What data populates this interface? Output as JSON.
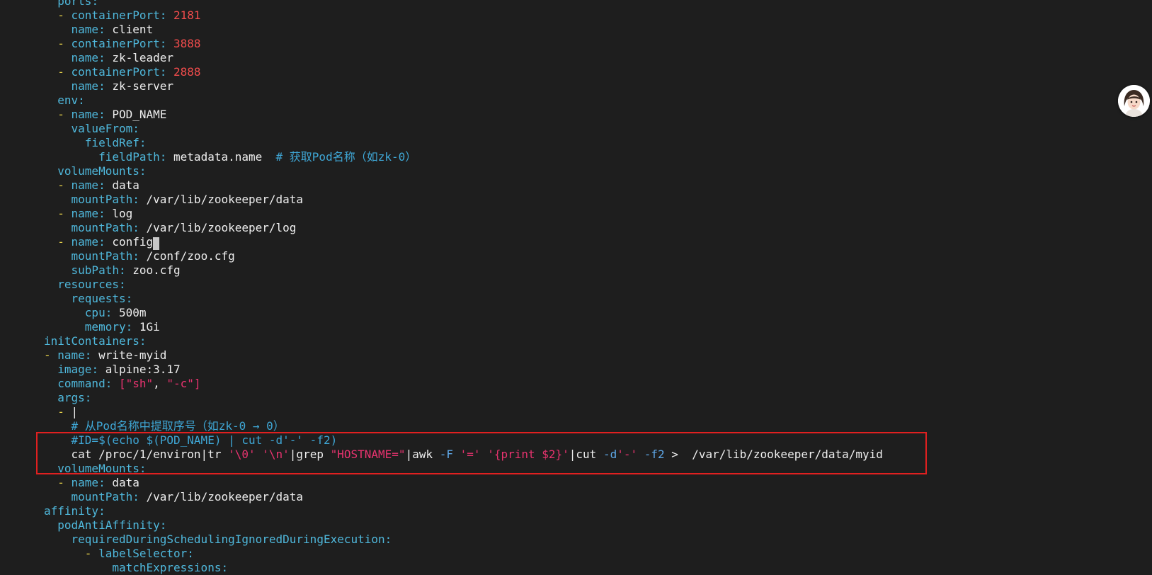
{
  "editor": {
    "lines": [
      [
        [
          "  ",
          "ws"
        ],
        [
          "ports",
          "key"
        ],
        [
          ":",
          "key"
        ]
      ],
      [
        [
          "  ",
          "ws"
        ],
        [
          "- ",
          "dash"
        ],
        [
          "containerPort",
          "key"
        ],
        [
          ": ",
          "key"
        ],
        [
          "2181",
          "num"
        ]
      ],
      [
        [
          "    ",
          "ws"
        ],
        [
          "name",
          "key"
        ],
        [
          ": ",
          "key"
        ],
        [
          "client",
          "val"
        ]
      ],
      [
        [
          "  ",
          "ws"
        ],
        [
          "- ",
          "dash"
        ],
        [
          "containerPort",
          "key"
        ],
        [
          ": ",
          "key"
        ],
        [
          "3888",
          "num"
        ]
      ],
      [
        [
          "    ",
          "ws"
        ],
        [
          "name",
          "key"
        ],
        [
          ": ",
          "key"
        ],
        [
          "zk-leader",
          "val"
        ]
      ],
      [
        [
          "  ",
          "ws"
        ],
        [
          "- ",
          "dash"
        ],
        [
          "containerPort",
          "key"
        ],
        [
          ": ",
          "key"
        ],
        [
          "2888",
          "num"
        ]
      ],
      [
        [
          "    ",
          "ws"
        ],
        [
          "name",
          "key"
        ],
        [
          ": ",
          "key"
        ],
        [
          "zk-server",
          "val"
        ]
      ],
      [
        [
          "  ",
          "ws"
        ],
        [
          "env",
          "key"
        ],
        [
          ":",
          "key"
        ]
      ],
      [
        [
          "  ",
          "ws"
        ],
        [
          "- ",
          "dash"
        ],
        [
          "name",
          "key"
        ],
        [
          ": ",
          "key"
        ],
        [
          "POD_NAME",
          "val"
        ]
      ],
      [
        [
          "    ",
          "ws"
        ],
        [
          "valueFrom",
          "key"
        ],
        [
          ":",
          "key"
        ]
      ],
      [
        [
          "      ",
          "ws"
        ],
        [
          "fieldRef",
          "key"
        ],
        [
          ":",
          "key"
        ]
      ],
      [
        [
          "        ",
          "ws"
        ],
        [
          "fieldPath",
          "key"
        ],
        [
          ": ",
          "key"
        ],
        [
          "metadata.name  ",
          "val"
        ],
        [
          "# 获取Pod名称（如zk-0）",
          "comment"
        ]
      ],
      [
        [
          "  ",
          "ws"
        ],
        [
          "volumeMounts",
          "key"
        ],
        [
          ":",
          "key"
        ]
      ],
      [
        [
          "  ",
          "ws"
        ],
        [
          "- ",
          "dash"
        ],
        [
          "name",
          "key"
        ],
        [
          ": ",
          "key"
        ],
        [
          "data",
          "val"
        ]
      ],
      [
        [
          "    ",
          "ws"
        ],
        [
          "mountPath",
          "key"
        ],
        [
          ": ",
          "key"
        ],
        [
          "/var/lib/zookeeper/data",
          "val"
        ]
      ],
      [
        [
          "  ",
          "ws"
        ],
        [
          "- ",
          "dash"
        ],
        [
          "name",
          "key"
        ],
        [
          ": ",
          "key"
        ],
        [
          "log",
          "val"
        ]
      ],
      [
        [
          "    ",
          "ws"
        ],
        [
          "mountPath",
          "key"
        ],
        [
          ": ",
          "key"
        ],
        [
          "/var/lib/zookeeper/log",
          "val"
        ]
      ],
      [
        [
          "  ",
          "ws"
        ],
        [
          "- ",
          "dash"
        ],
        [
          "name",
          "key"
        ],
        [
          ": ",
          "key"
        ],
        [
          "config",
          "val"
        ],
        [
          " ",
          "cursor"
        ]
      ],
      [
        [
          "    ",
          "ws"
        ],
        [
          "mountPath",
          "key"
        ],
        [
          ": ",
          "key"
        ],
        [
          "/conf/zoo.cfg",
          "val"
        ]
      ],
      [
        [
          "    ",
          "ws"
        ],
        [
          "subPath",
          "key"
        ],
        [
          ": ",
          "key"
        ],
        [
          "zoo.cfg",
          "val"
        ]
      ],
      [
        [
          "  ",
          "ws"
        ],
        [
          "resources",
          "key"
        ],
        [
          ":",
          "key"
        ]
      ],
      [
        [
          "    ",
          "ws"
        ],
        [
          "requests",
          "key"
        ],
        [
          ":",
          "key"
        ]
      ],
      [
        [
          "      ",
          "ws"
        ],
        [
          "cpu",
          "key"
        ],
        [
          ": ",
          "key"
        ],
        [
          "500m",
          "val"
        ]
      ],
      [
        [
          "      ",
          "ws"
        ],
        [
          "memory",
          "key"
        ],
        [
          ": ",
          "key"
        ],
        [
          "1Gi",
          "val"
        ]
      ],
      [
        [
          "",
          "ws"
        ],
        [
          "initContainers",
          "key"
        ],
        [
          ":",
          "key"
        ]
      ],
      [
        [
          "",
          "ws"
        ],
        [
          "- ",
          "dash"
        ],
        [
          "name",
          "key"
        ],
        [
          ": ",
          "key"
        ],
        [
          "write-myid",
          "val"
        ]
      ],
      [
        [
          "  ",
          "ws"
        ],
        [
          "image",
          "key"
        ],
        [
          ": ",
          "key"
        ],
        [
          "alpine:3.17",
          "val"
        ]
      ],
      [
        [
          "  ",
          "ws"
        ],
        [
          "command",
          "key"
        ],
        [
          ": ",
          "key"
        ],
        [
          "[",
          "str"
        ],
        [
          "\"sh\"",
          "str"
        ],
        [
          ", ",
          "val"
        ],
        [
          "\"-c\"",
          "str"
        ],
        [
          "]",
          "str"
        ]
      ],
      [
        [
          "  ",
          "ws"
        ],
        [
          "args",
          "key"
        ],
        [
          ":",
          "key"
        ]
      ],
      [
        [
          "  ",
          "ws"
        ],
        [
          "- ",
          "dash"
        ],
        [
          "|",
          "val"
        ]
      ],
      [
        [
          "    ",
          "ws"
        ],
        [
          "# 从Pod名称中提取序号（如zk-0 → 0）",
          "comment"
        ]
      ],
      [
        [
          "    ",
          "ws"
        ],
        [
          "#ID=$(echo $(POD_NAME) | cut -d'-' -f2)",
          "comment"
        ]
      ],
      [
        [
          "    ",
          "ws"
        ],
        [
          "cat /proc/1/environ|tr ",
          "val"
        ],
        [
          "'\\0'",
          "str"
        ],
        [
          " ",
          "val"
        ],
        [
          "'\\n'",
          "str"
        ],
        [
          "|grep ",
          "val"
        ],
        [
          "\"HOSTNAME=\"",
          "str"
        ],
        [
          "|awk ",
          "val"
        ],
        [
          "-F",
          "flag"
        ],
        [
          " ",
          "val"
        ],
        [
          "'='",
          "str"
        ],
        [
          " ",
          "val"
        ],
        [
          "'{print $2}'",
          "str"
        ],
        [
          "|cut ",
          "val"
        ],
        [
          "-d",
          "flag"
        ],
        [
          "'-'",
          "str"
        ],
        [
          " ",
          "val"
        ],
        [
          "-f2",
          "flag"
        ],
        [
          " >  /var/lib/zookeeper/data/myid",
          "val"
        ]
      ],
      [
        [
          "  ",
          "ws"
        ],
        [
          "volumeMounts",
          "key"
        ],
        [
          ":",
          "key"
        ]
      ],
      [
        [
          "  ",
          "ws"
        ],
        [
          "- ",
          "dash"
        ],
        [
          "name",
          "key"
        ],
        [
          ": ",
          "key"
        ],
        [
          "data",
          "val"
        ]
      ],
      [
        [
          "    ",
          "ws"
        ],
        [
          "mountPath",
          "key"
        ],
        [
          ": ",
          "key"
        ],
        [
          "/var/lib/zookeeper/data",
          "val"
        ]
      ],
      [
        [
          "",
          "ws"
        ],
        [
          "affinity",
          "key"
        ],
        [
          ":",
          "key"
        ]
      ],
      [
        [
          "  ",
          "ws"
        ],
        [
          "podAntiAffinity",
          "key"
        ],
        [
          ":",
          "key"
        ]
      ],
      [
        [
          "    ",
          "ws"
        ],
        [
          "requiredDuringSchedulingIgnoredDuringExecution",
          "key"
        ],
        [
          ":",
          "key"
        ]
      ],
      [
        [
          "      ",
          "ws"
        ],
        [
          "- ",
          "dash"
        ],
        [
          "labelSelector",
          "key"
        ],
        [
          ":",
          "key"
        ]
      ],
      [
        [
          "          ",
          "ws"
        ],
        [
          "matchExpressions",
          "key"
        ],
        [
          ":",
          "key"
        ]
      ]
    ]
  },
  "avatar": {
    "icon": "assistant-avatar-icon"
  },
  "colors": {
    "background": "#1e1e1e",
    "key": "#4fb8dc",
    "dash": "#e5d14a",
    "number": "#f14c4c",
    "string": "#e8336f",
    "comment": "#3fa7d6",
    "text": "#eeeeee",
    "highlight_border": "#e02020"
  }
}
